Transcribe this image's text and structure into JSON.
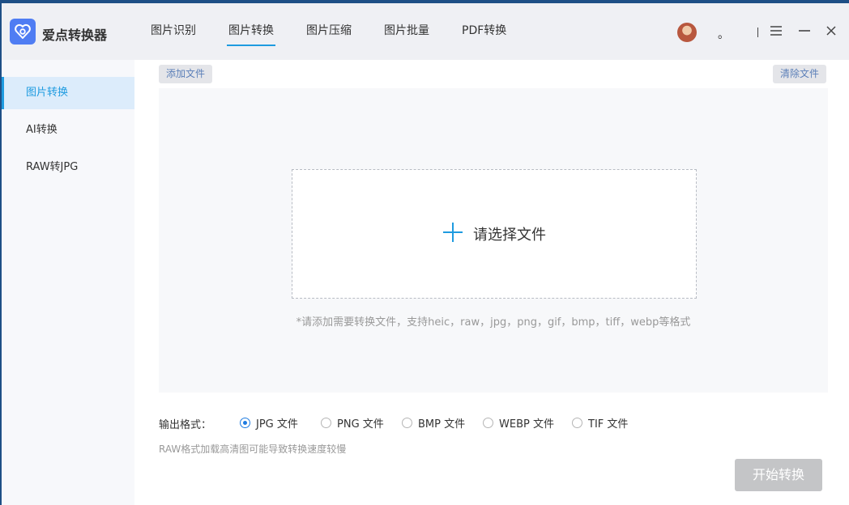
{
  "app": {
    "name": "爱点转换器"
  },
  "nav": {
    "tabs": [
      "图片识别",
      "图片转换",
      "图片压缩",
      "图片批量",
      "PDF转换"
    ],
    "active_index": 1
  },
  "user": {
    "name": "。"
  },
  "sidebar": {
    "items": [
      "图片转换",
      "AI转换",
      "RAW转JPG"
    ],
    "active_index": 0
  },
  "toolbar": {
    "add_file": "添加文件",
    "clear_files": "清除文件"
  },
  "drop": {
    "prompt": "请选择文件",
    "hint": "*请添加需要转换文件，支持heic，raw，jpg，png，gif，bmp，tiff，webp等格式"
  },
  "output": {
    "label": "输出格式：",
    "options": [
      "JPG 文件",
      "PNG 文件",
      "BMP 文件",
      "WEBP 文件",
      "TIF 文件"
    ],
    "selected_index": 0,
    "note": "RAW格式加载高清图可能导致转换速度较慢"
  },
  "actions": {
    "start": "开始转换"
  },
  "colors": {
    "accent": "#1e9be0",
    "button_disabled": "#c4c5c7"
  }
}
